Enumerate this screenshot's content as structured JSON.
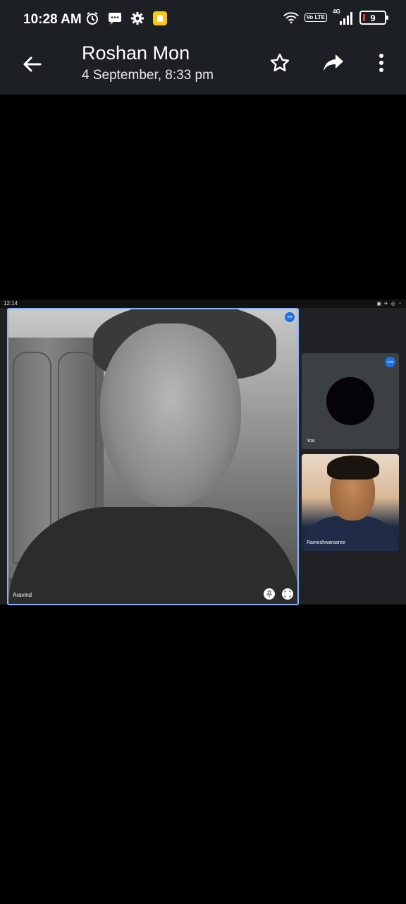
{
  "status_bar": {
    "time": "10:28 AM",
    "network": "4G",
    "lte_label": "Vo LTE",
    "battery": "9",
    "icons": [
      "alarm-icon",
      "message-icon",
      "gear-icon",
      "notification-app-icon",
      "wifi-icon",
      "signal-icon",
      "battery-icon"
    ]
  },
  "app_bar": {
    "title": "Roshan Mon",
    "subtitle": "4 September, 8:33 pm",
    "icons": [
      "back-arrow-icon",
      "star-icon",
      "share-icon",
      "more-vert-icon"
    ]
  },
  "embedded_screenshot": {
    "status_time": "12:14",
    "participants": [
      {
        "name": "Aravind",
        "role": "main"
      },
      {
        "name": "You",
        "role": "self"
      },
      {
        "name": "Rameshwarasree",
        "role": "thumbnail"
      }
    ]
  }
}
